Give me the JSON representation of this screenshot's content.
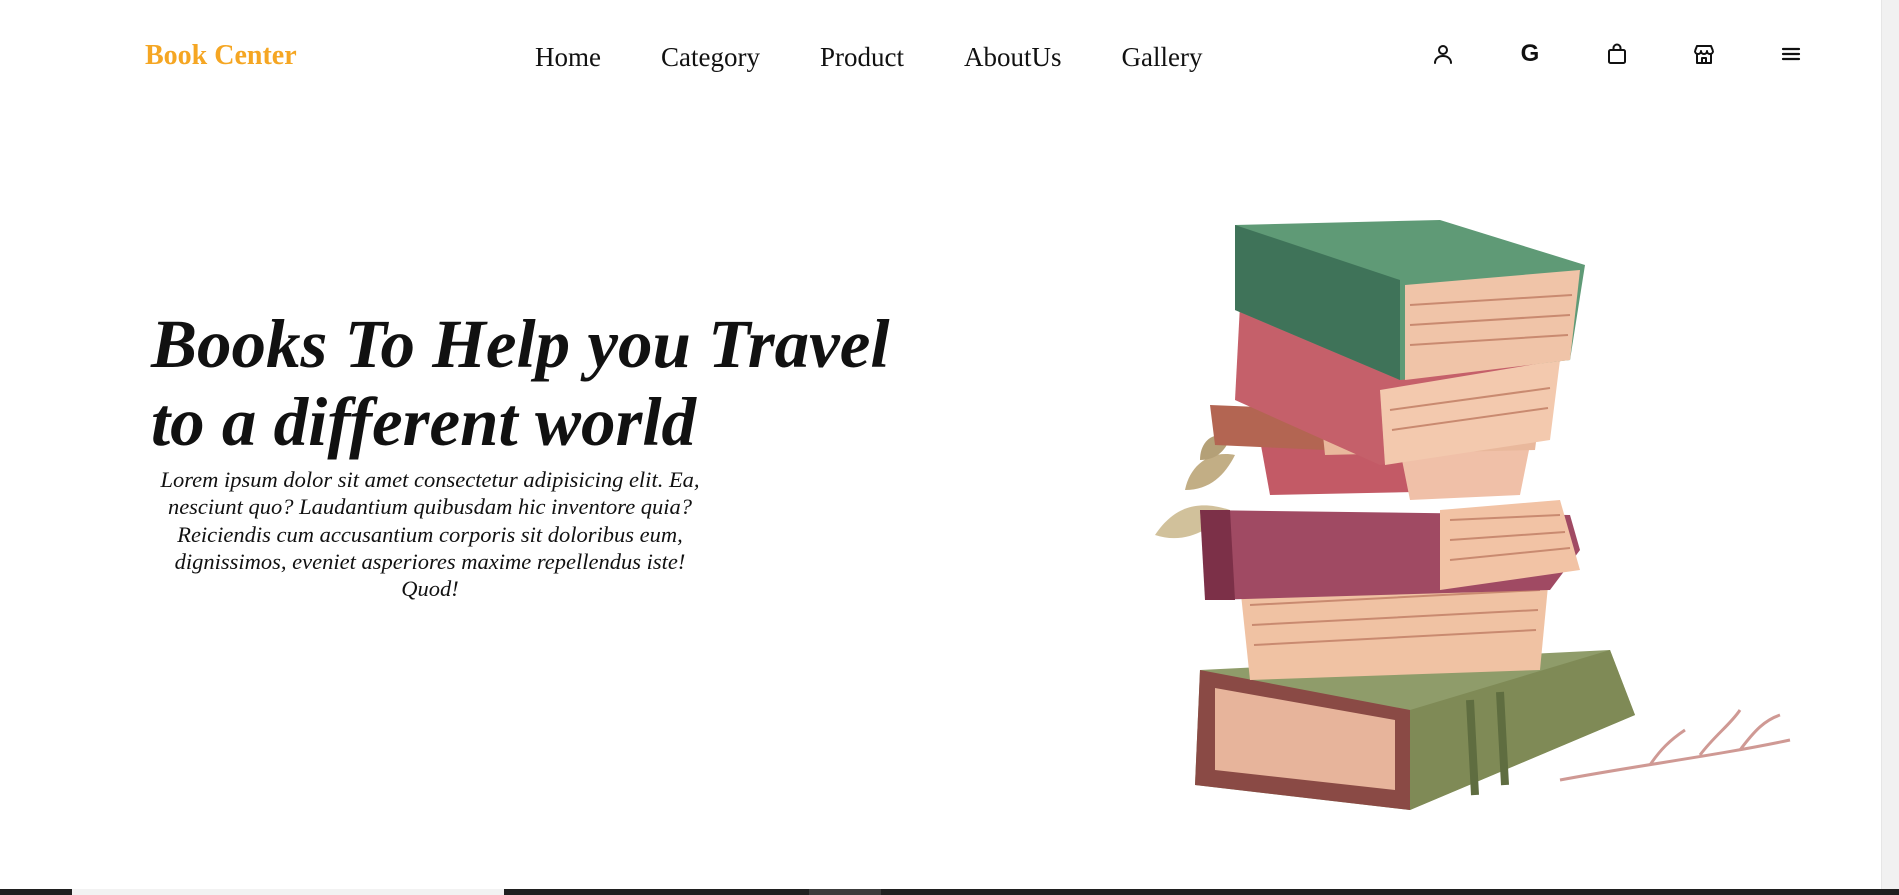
{
  "brand": {
    "name": "Book Center",
    "color": "#f5a623"
  },
  "nav": {
    "links": [
      {
        "label": "Home"
      },
      {
        "label": "Category"
      },
      {
        "label": "Product"
      },
      {
        "label": "AboutUs"
      },
      {
        "label": "Gallery"
      }
    ],
    "icons": [
      "user-icon",
      "google-icon",
      "shopping-bag-icon",
      "store-icon",
      "menu-icon"
    ],
    "google_letter": "G"
  },
  "hero": {
    "title_line1": "Books To Help you Travel",
    "title_line2": "to a different world",
    "description": "Lorem ipsum dolor sit amet consectetur adipisicing elit. Ea, nesciunt quo? Laudantium quibusdam hic inventore quia? Reiciendis cum accusantium corporis sit doloribus eum, dignissimos, eveniet asperiores maxime repellendus iste! Quod!",
    "image": "stacked-books-watercolor-illustration"
  }
}
